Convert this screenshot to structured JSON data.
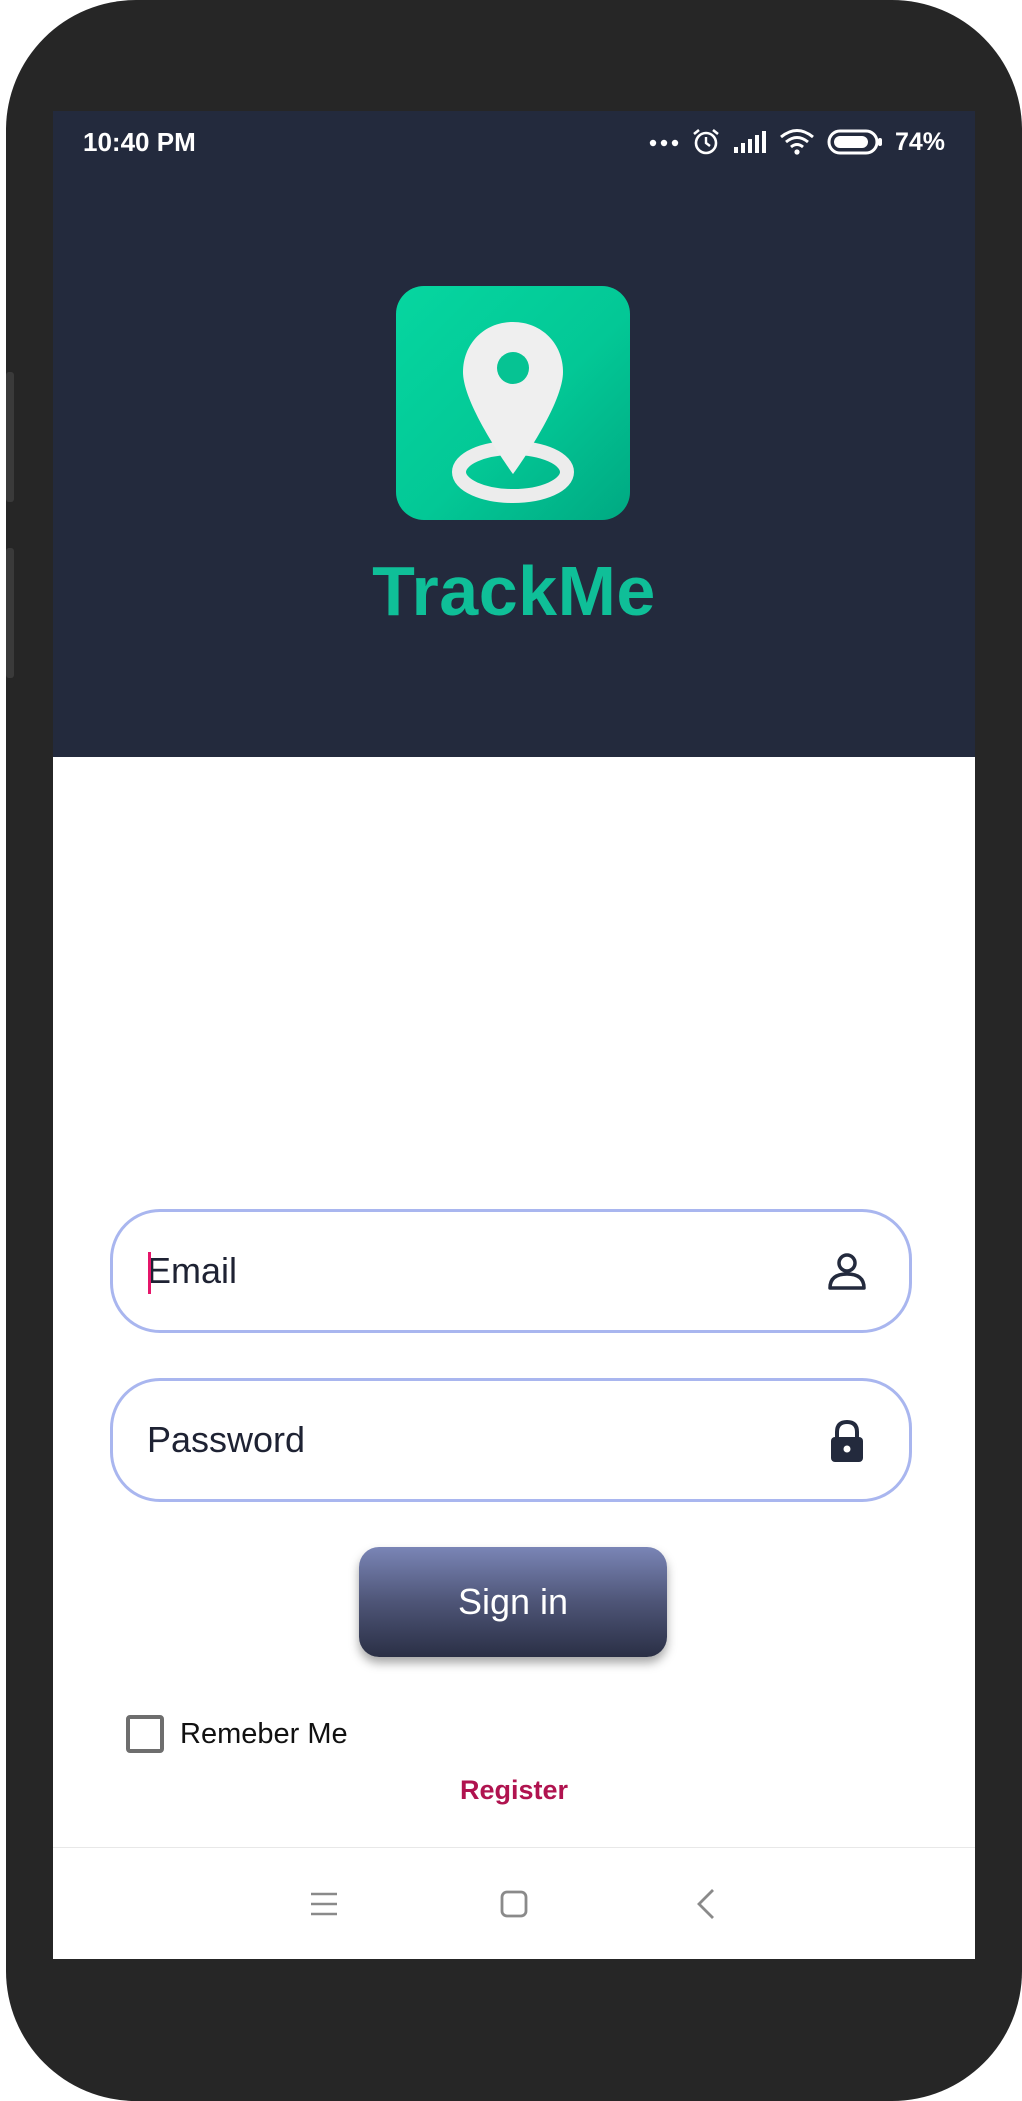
{
  "status_bar": {
    "time": "10:40 PM",
    "battery_percent": "74%",
    "icons": [
      "more-dots-icon",
      "alarm-icon",
      "signal-icon",
      "wifi-icon",
      "battery-icon"
    ]
  },
  "header": {
    "background": "#232a3d",
    "app_icon": "map-pin-icon",
    "app_name": "TrackMe",
    "accent": "#0fbf98"
  },
  "form": {
    "email": {
      "placeholder": "Email",
      "value": "",
      "icon": "user-icon"
    },
    "password": {
      "placeholder": "Password",
      "value": "",
      "icon": "lock-icon"
    },
    "sign_in_label": "Sign in",
    "remember_label": "Remeber Me",
    "remember_checked": false,
    "register_label": "Register",
    "register_color": "#b0134f"
  },
  "nav_bar": {
    "icons": [
      "menu-icon",
      "home-icon",
      "back-icon"
    ]
  }
}
